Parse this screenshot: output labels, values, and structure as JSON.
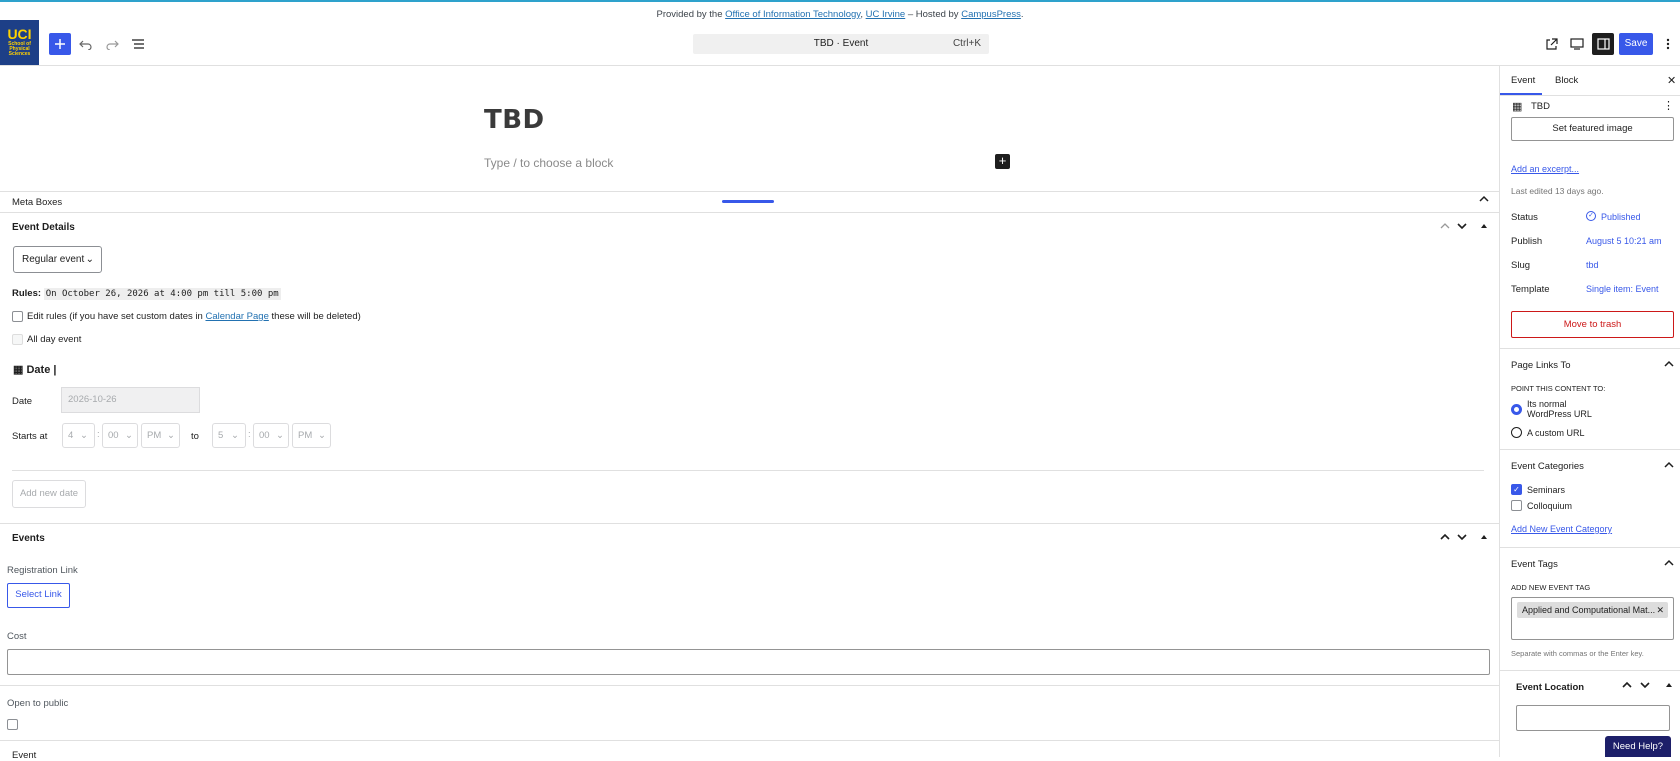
{
  "provided": {
    "prefix": "Provided by the",
    "oit": "Office of Information Technology",
    "sep": ",",
    "uci": "UC Irvine",
    "hosted": "– Hosted by",
    "campuspress": "CampusPress",
    "end": "."
  },
  "logo": {
    "big": "UCI",
    "small": "School of Physical Sciences"
  },
  "toolbar": {
    "doc_title": "TBD · Event",
    "shortcut": "Ctrl+K",
    "save_label": "Save"
  },
  "editor": {
    "post_title": "TBD",
    "block_placeholder": "Type / to choose a block"
  },
  "metaboxes": {
    "label": "Meta Boxes",
    "event_details": {
      "heading": "Event Details",
      "event_type": "Regular event",
      "rules_label": "Rules:",
      "rules_value": "On October 26, 2026 at 4:00 pm till 5:00 pm",
      "edit_rules_pre": "Edit rules (if you have set custom dates in",
      "edit_rules_link": "Calendar Page",
      "edit_rules_post": "these will be deleted)",
      "all_day": "All day event",
      "date_heading": "Date |",
      "date_label": "Date",
      "date_value": "2026-10-26",
      "starts_label": "Starts at",
      "start_hour": "4",
      "start_min": "00",
      "start_ampm": "PM",
      "to_label": "to",
      "end_hour": "5",
      "end_min": "00",
      "end_ampm": "PM",
      "colon": ":",
      "add_date": "Add new date"
    },
    "events": {
      "heading": "Events",
      "registration_label": "Registration Link",
      "select_link": "Select Link",
      "cost_label": "Cost",
      "open_label": "Open to public",
      "next_heading": "Event"
    }
  },
  "sidebar": {
    "tab_event": "Event",
    "tab_block": "Block",
    "post_name": "TBD",
    "featured": "Set featured image",
    "excerpt": "Add an excerpt...",
    "last_edited": "Last edited 13 days ago.",
    "status_label": "Status",
    "status_value": "Published",
    "publish_label": "Publish",
    "publish_value": "August 5 10:21 am",
    "slug_label": "Slug",
    "slug_value": "tbd",
    "template_label": "Template",
    "template_value": "Single item: Event",
    "trash": "Move to trash",
    "page_links_heading": "Page Links To",
    "point_label": "POINT THIS CONTENT TO:",
    "normal_url_1": "Its normal",
    "normal_url_2": "WordPress URL",
    "custom_url": "A custom URL",
    "categories_heading": "Event Categories",
    "cat1": "Seminars",
    "cat2": "Colloquium",
    "add_category": "Add New Event Category",
    "tags_heading": "Event Tags",
    "add_tag_label": "ADD NEW EVENT TAG",
    "tag1": "Applied and Computational Mat...",
    "tag_hint": "Separate with commas or the Enter key.",
    "location_heading": "Event Location"
  },
  "help": "Need Help?",
  "colors": {
    "accent": "#3858e9",
    "danger": "#cc1818",
    "logo_bg": "#1d3f87"
  }
}
